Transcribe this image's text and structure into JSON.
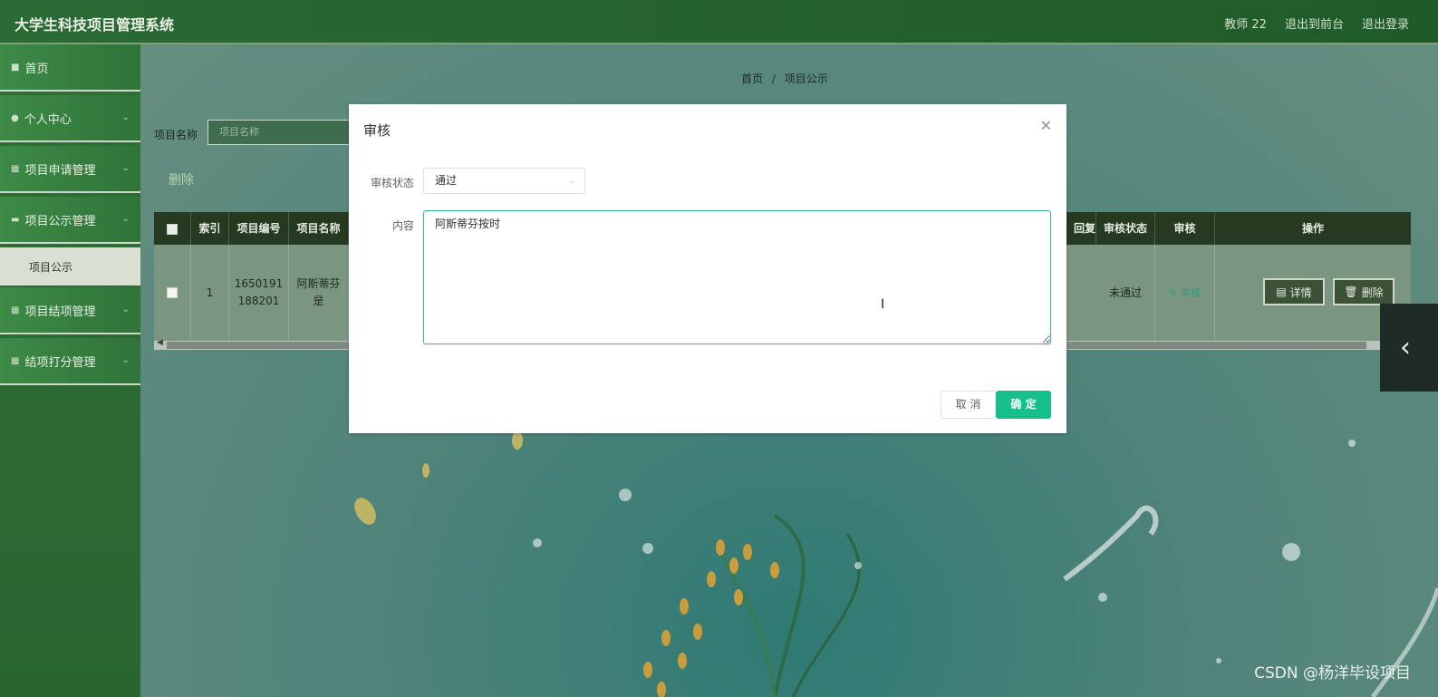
{
  "header": {
    "title": "大学生科技项目管理系统",
    "user": "教师 22",
    "back_to_front": "退出到前台",
    "logout": "退出登录"
  },
  "sidebar": {
    "items": [
      {
        "label": "首页",
        "icon": "home-icon"
      },
      {
        "label": "个人中心",
        "icon": "user-icon"
      },
      {
        "label": "项目申请管理",
        "icon": "grid-icon"
      },
      {
        "label": "项目公示管理",
        "icon": "folder-icon"
      },
      {
        "label": "项目结项管理",
        "icon": "grid-icon"
      },
      {
        "label": "结项打分管理",
        "icon": "grid-icon"
      }
    ],
    "sub_item": "项目公示"
  },
  "breadcrumb": {
    "home": "首页",
    "separator": "/",
    "current": "项目公示"
  },
  "search": {
    "label": "项目名称",
    "placeholder": "项目名称"
  },
  "toolbar": {
    "bulk_delete": "删除"
  },
  "table": {
    "headers_left": [
      "索引",
      "项目编号",
      "项目名称"
    ],
    "headers_right": [
      "回复",
      "审核状态",
      "审核",
      "操作"
    ],
    "row": {
      "index": "1",
      "number_line1": "1650191",
      "number_line2": "188201",
      "name_line1": "阿斯蒂芬",
      "name_line2": "是",
      "audit_status": "未通过",
      "audit_link": "审核",
      "detail_btn": "详情",
      "delete_btn": "删除"
    }
  },
  "dialog": {
    "title": "审核",
    "status_label": "审核状态",
    "status_value": "通过",
    "content_label": "内容",
    "content_value": "阿斯蒂芬按时",
    "cancel": "取 消",
    "confirm": "确 定"
  },
  "watermark": "CSDN @杨洋毕设项目",
  "colors": {
    "header_bg": "#24612d",
    "sidebar_bg": "#2f7339",
    "confirm_btn": "#17bf8a",
    "textarea_focus": "#2fb39a",
    "table_header": "#263a22"
  }
}
